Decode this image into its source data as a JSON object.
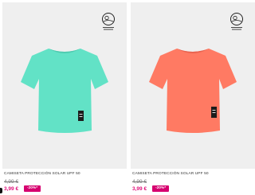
{
  "products": [
    {
      "name": "CAMISETA PROTECCIÓN SOLAR UPF 50",
      "old_price": "4,99 €",
      "new_price": "3,99 €",
      "discount": "-20%*",
      "shirt_color": "#62e2c6",
      "shirt_shade": "#4fcbb0",
      "badge_icon": "sun-protection-badge-icon"
    },
    {
      "name": "CAMISETA PROTECCIÓN SOLAR UPF 50",
      "old_price": "4,99 €",
      "new_price": "3,99 €",
      "discount": "-20%*",
      "shirt_color": "#ff7a63",
      "shirt_shade": "#ea6450",
      "badge_icon": "sun-protection-badge-icon"
    }
  ]
}
